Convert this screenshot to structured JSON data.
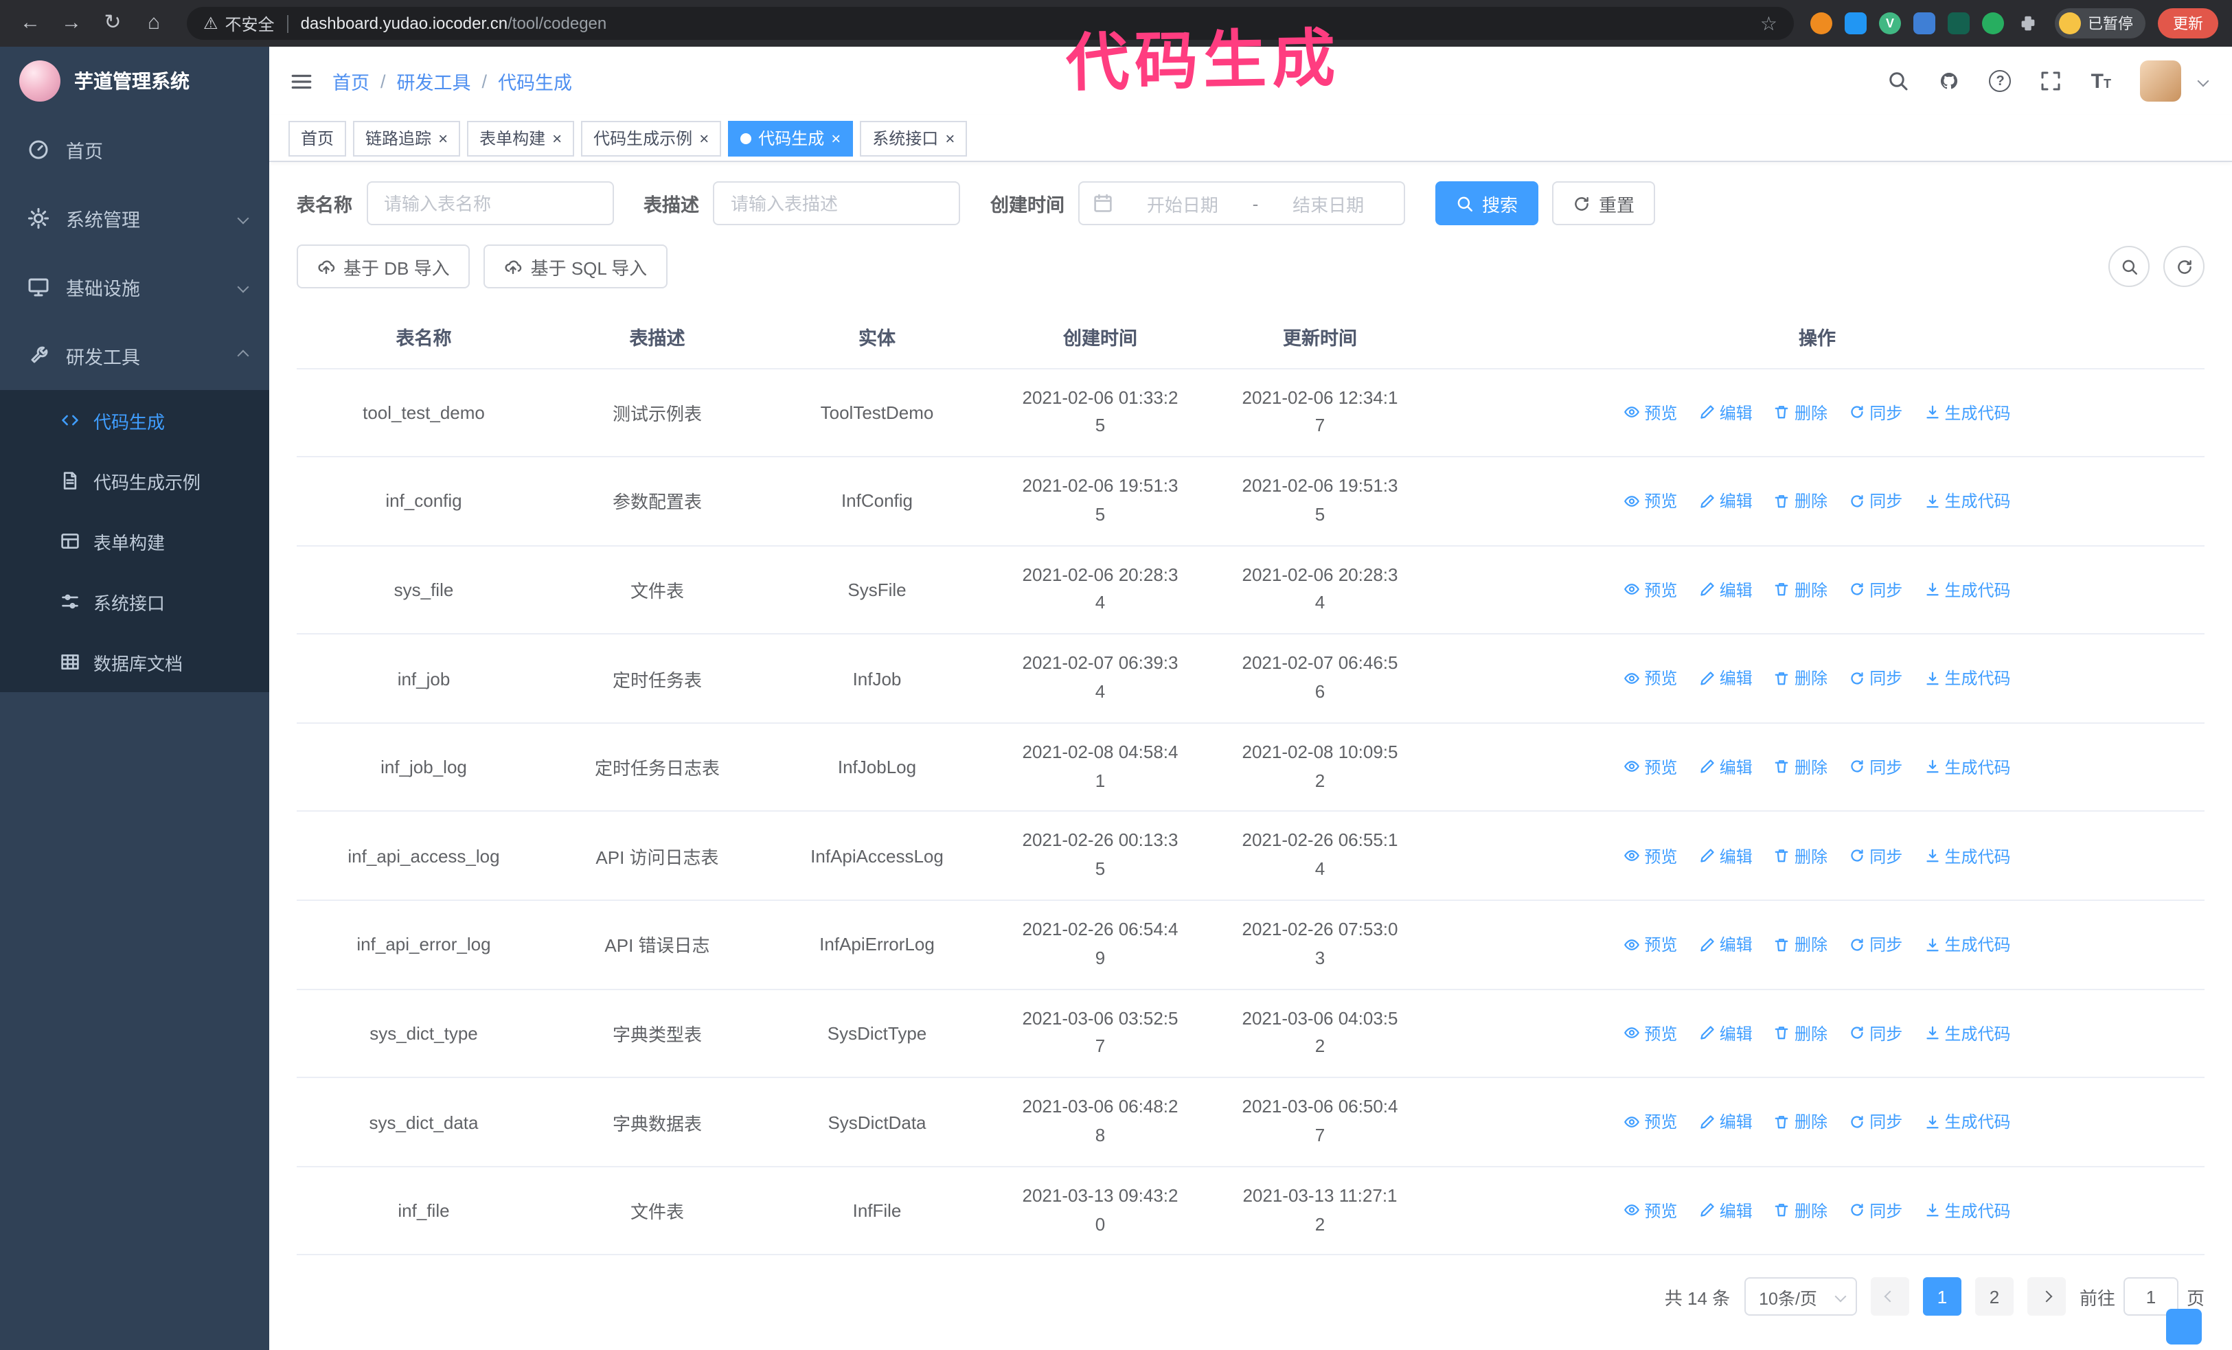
{
  "colors": {
    "primary": "#409eff",
    "annotation": "#ff3d80",
    "sidebar_bg": "#304156",
    "sidebar_sub_bg": "#1f2d3d",
    "chrome_bg": "#2b2c30"
  },
  "annotation": {
    "text": "代码生成"
  },
  "browser": {
    "security_label": "不安全",
    "url_host": "dashboard.yudao.iocoder.cn",
    "url_path": "/tool/codegen",
    "paused_badge": "已暂停",
    "update_button": "更新"
  },
  "icons": {
    "back": "←",
    "forward": "→",
    "reload": "↻",
    "home": "⌂",
    "warning": "⚠",
    "star": "☆",
    "close": "×",
    "separator": "/",
    "question": "?",
    "font_size": "T",
    "vue": "V"
  },
  "sidebar": {
    "logo_title": "芋道管理系统",
    "items": [
      {
        "label": "首页"
      },
      {
        "label": "系统管理"
      },
      {
        "label": "基础设施"
      },
      {
        "label": "研发工具"
      }
    ],
    "sub_items": [
      {
        "label": "代码生成"
      },
      {
        "label": "代码生成示例"
      },
      {
        "label": "表单构建"
      },
      {
        "label": "系统接口"
      },
      {
        "label": "数据库文档"
      }
    ]
  },
  "breadcrumb": [
    "首页",
    "研发工具",
    "代码生成"
  ],
  "tabs": [
    {
      "label": "首页"
    },
    {
      "label": "链路追踪"
    },
    {
      "label": "表单构建"
    },
    {
      "label": "代码生成示例"
    },
    {
      "label": "代码生成"
    },
    {
      "label": "系统接口"
    }
  ],
  "filters": {
    "table_name_label": "表名称",
    "table_name_placeholder": "请输入表名称",
    "table_desc_label": "表描述",
    "table_desc_placeholder": "请输入表描述",
    "create_time_label": "创建时间",
    "date_start_placeholder": "开始日期",
    "date_separator": "-",
    "date_end_placeholder": "结束日期",
    "search_button": "搜索",
    "reset_button": "重置"
  },
  "toolbar": {
    "import_db_button": "基于 DB 导入",
    "import_sql_button": "基于 SQL 导入"
  },
  "table": {
    "columns": [
      "表名称",
      "表描述",
      "实体",
      "创建时间",
      "更新时间",
      "操作"
    ],
    "actions": [
      "预览",
      "编辑",
      "删除",
      "同步",
      "生成代码"
    ],
    "rows": [
      {
        "name": "tool_test_demo",
        "desc": "测试示例表",
        "entity": "ToolTestDemo",
        "created": "2021-02-06 01:33:25",
        "updated": "2021-02-06 12:34:17"
      },
      {
        "name": "inf_config",
        "desc": "参数配置表",
        "entity": "InfConfig",
        "created": "2021-02-06 19:51:35",
        "updated": "2021-02-06 19:51:35"
      },
      {
        "name": "sys_file",
        "desc": "文件表",
        "entity": "SysFile",
        "created": "2021-02-06 20:28:34",
        "updated": "2021-02-06 20:28:34"
      },
      {
        "name": "inf_job",
        "desc": "定时任务表",
        "entity": "InfJob",
        "created": "2021-02-07 06:39:34",
        "updated": "2021-02-07 06:46:56"
      },
      {
        "name": "inf_job_log",
        "desc": "定时任务日志表",
        "entity": "InfJobLog",
        "created": "2021-02-08 04:58:41",
        "updated": "2021-02-08 10:09:52"
      },
      {
        "name": "inf_api_access_log",
        "desc": "API 访问日志表",
        "entity": "InfApiAccessLog",
        "created": "2021-02-26 00:13:35",
        "updated": "2021-02-26 06:55:14"
      },
      {
        "name": "inf_api_error_log",
        "desc": "API 错误日志",
        "entity": "InfApiErrorLog",
        "created": "2021-02-26 06:54:49",
        "updated": "2021-02-26 07:53:03"
      },
      {
        "name": "sys_dict_type",
        "desc": "字典类型表",
        "entity": "SysDictType",
        "created": "2021-03-06 03:52:57",
        "updated": "2021-03-06 04:03:52"
      },
      {
        "name": "sys_dict_data",
        "desc": "字典数据表",
        "entity": "SysDictData",
        "created": "2021-03-06 06:48:28",
        "updated": "2021-03-06 06:50:47"
      },
      {
        "name": "inf_file",
        "desc": "文件表",
        "entity": "InfFile",
        "created": "2021-03-13 09:43:20",
        "updated": "2021-03-13 11:27:12"
      }
    ]
  },
  "pagination": {
    "total": "共 14 条",
    "page_size": "10条/页",
    "pages": [
      "1",
      "2"
    ],
    "goto_label": "前往",
    "goto_value": "1",
    "goto_suffix": "页"
  }
}
